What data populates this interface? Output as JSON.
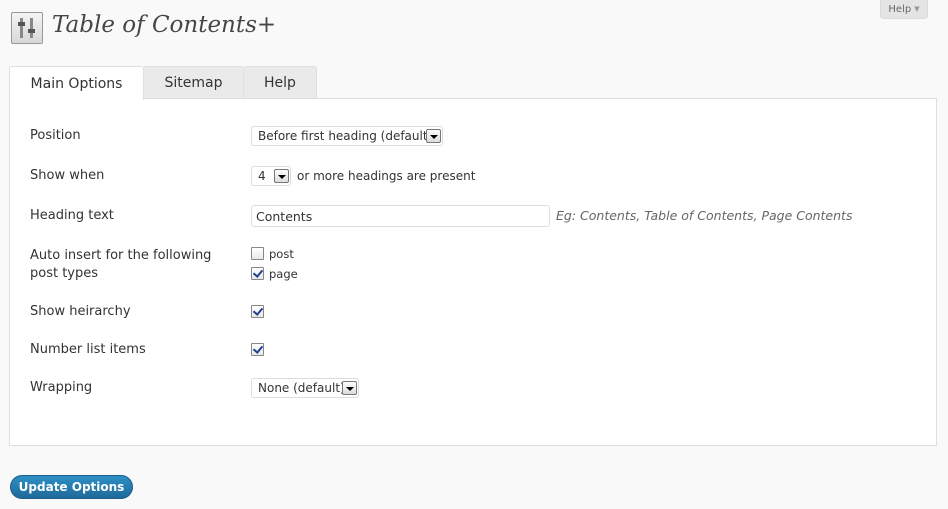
{
  "header": {
    "title": "Table of Contents+",
    "help_label": "Help"
  },
  "tabs": [
    {
      "label": "Main Options",
      "active": true
    },
    {
      "label": "Sitemap",
      "active": false
    },
    {
      "label": "Help",
      "active": false
    }
  ],
  "options": {
    "position": {
      "label": "Position",
      "value": "Before first heading (default)"
    },
    "show_when": {
      "label": "Show when",
      "value": "4",
      "suffix": "or more headings are present"
    },
    "heading_text": {
      "label": "Heading text",
      "value": "Contents",
      "hint": "Eg: Contents, Table of Contents, Page Contents"
    },
    "auto_insert": {
      "label_line1": "Auto insert for the following",
      "label_line2": "post types",
      "types": [
        {
          "label": "post",
          "checked": false
        },
        {
          "label": "page",
          "checked": true
        }
      ]
    },
    "show_hierarchy": {
      "label": "Show heirarchy",
      "checked": true
    },
    "number_list_items": {
      "label": "Number list items",
      "checked": true
    },
    "wrapping": {
      "label": "Wrapping",
      "value": "None (default)"
    }
  },
  "footer": {
    "update_label": "Update Options"
  },
  "colors": {
    "accent": "#21759b",
    "checkmark": "#25408f"
  }
}
